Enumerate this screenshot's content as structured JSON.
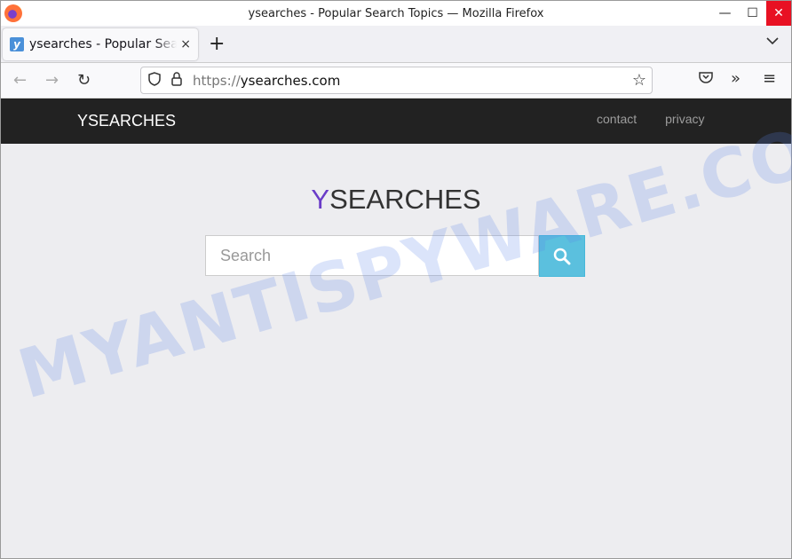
{
  "window": {
    "title": "ysearches - Popular Search Topics — Mozilla Firefox",
    "minimize": "—",
    "maximize": "☐",
    "close": "✕"
  },
  "tab": {
    "favicon": "y",
    "title": "ysearches - Popular Search Topics",
    "close": "×",
    "new_tab": "+",
    "list_all": "⌄"
  },
  "toolbar": {
    "back": "←",
    "forward": "→",
    "reload": "↻",
    "url_prefix": "https://",
    "url_host": "ysearches.com",
    "star": "☆",
    "pocket": "⛉",
    "overflow": "»",
    "menu": "≡"
  },
  "site": {
    "brand": "YSEARCHES",
    "nav": [
      "contact",
      "privacy"
    ],
    "logo_first": "Y",
    "logo_rest": "SEARCHES",
    "search_placeholder": "Search",
    "accent": "#6a3cc8",
    "button_color": "#5bc0de"
  },
  "watermark": "MYANTISPYWARE.COM"
}
